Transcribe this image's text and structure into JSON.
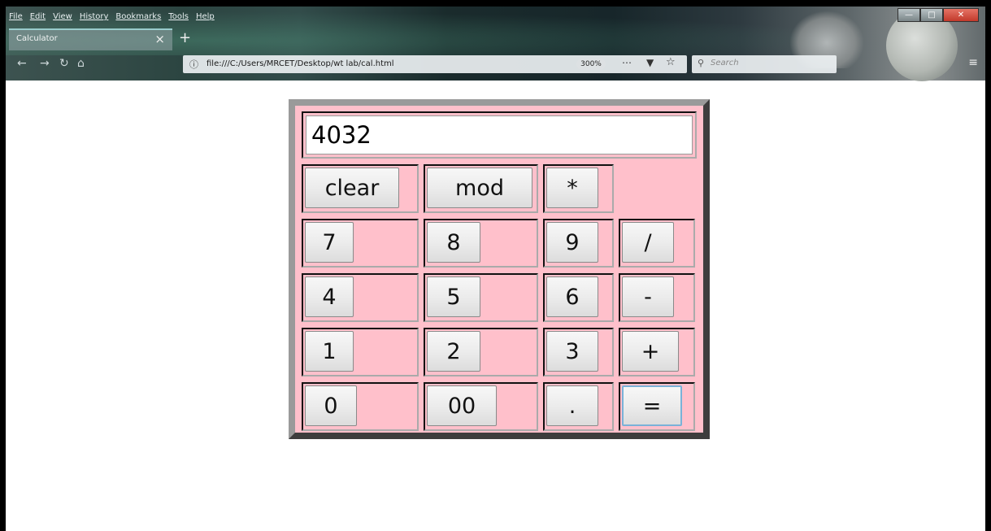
{
  "browser": {
    "menu": [
      "File",
      "Edit",
      "View",
      "History",
      "Bookmarks",
      "Tools",
      "Help"
    ],
    "tab_title": "Calculator",
    "tab_close": "×",
    "new_tab": "+",
    "url": "file:///C:/Users/MRCET/Desktop/wt lab/cal.html",
    "zoom": "300%",
    "search_placeholder": "Search",
    "icons": [
      "back-icon",
      "forward-icon",
      "reload-icon",
      "home-icon",
      "info-icon",
      "more-icon",
      "pocket-icon",
      "bookmark-star-icon",
      "search-icon",
      "menu-icon"
    ]
  },
  "calculator": {
    "display": "4032",
    "buttons": {
      "clear": "clear",
      "mod": "mod",
      "multiply": "*",
      "seven": "7",
      "eight": "8",
      "nine": "9",
      "divide": "/",
      "four": "4",
      "five": "5",
      "six": "6",
      "minus": "-",
      "one": "1",
      "two": "2",
      "three": "3",
      "plus": "+",
      "zero": "0",
      "double_zero": "00",
      "dot": ".",
      "equals": "="
    },
    "colors": {
      "background": "#ffc0cb",
      "border_light": "#9a9a9a",
      "border_dark": "#3d3d3d"
    }
  }
}
